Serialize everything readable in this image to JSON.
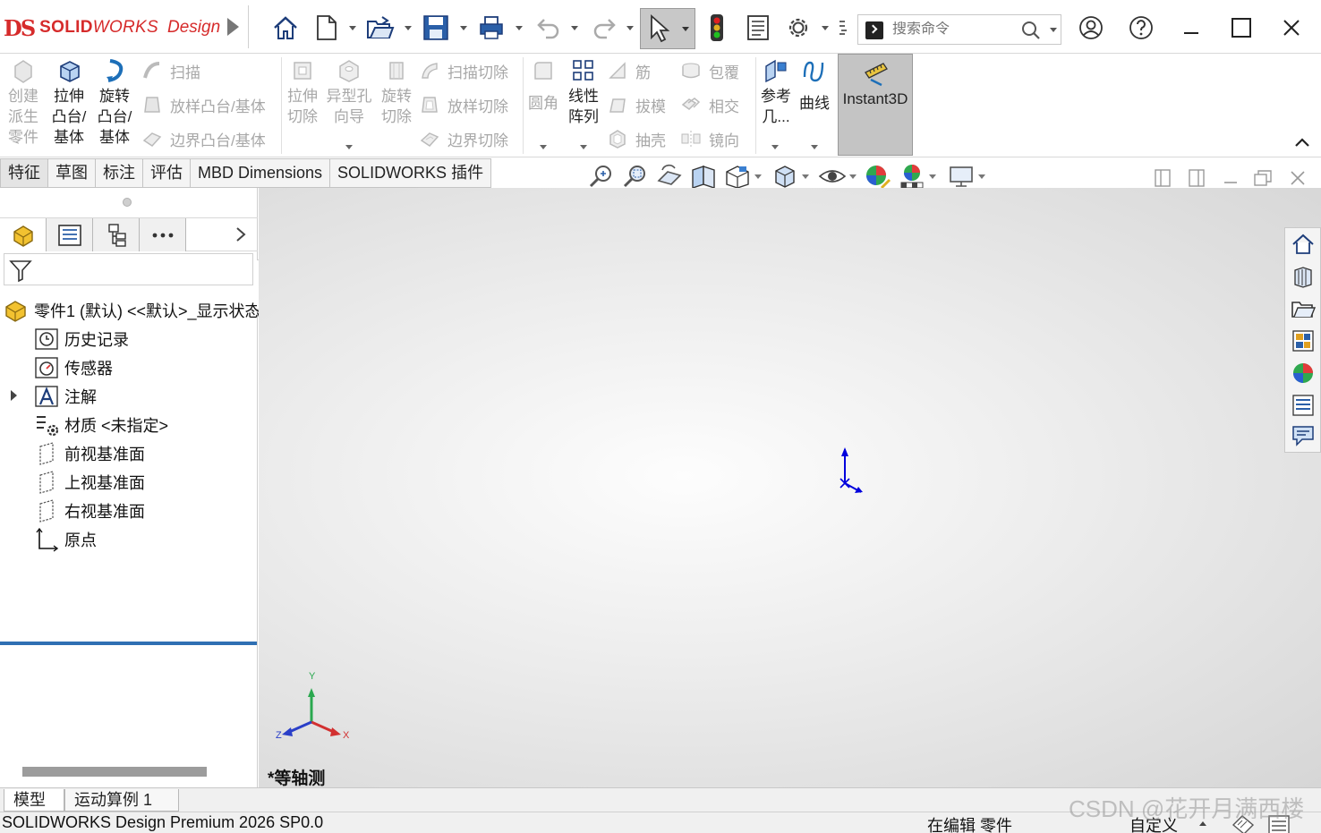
{
  "app": {
    "logo_ds": "DS",
    "logo_solid": "SOLID",
    "logo_works": "WORKS",
    "logo_design": "Design",
    "search_placeholder": "搜索命令"
  },
  "ribbon": {
    "create_derived": "创建\n派生\n零件",
    "extrude_boss": "拉伸\n凸台/\n基体",
    "revolve_boss": "旋转\n凸台/\n基体",
    "sweep": "扫描",
    "loft_boss": "放样凸台/基体",
    "boundary_boss": "边界凸台/基体",
    "extrude_cut": "拉伸\n切除",
    "hole_wizard": "异型孔\n向导",
    "revolve_cut": "旋转\n切除",
    "sweep_cut": "扫描切除",
    "loft_cut": "放样切除",
    "boundary_cut": "边界切除",
    "fillet": "圆角",
    "linear_pattern": "线性\n阵列",
    "rib": "筋",
    "draft": "拔模",
    "shell": "抽壳",
    "wrap": "包覆",
    "intersect": "相交",
    "mirror": "镜向",
    "reference_geometry": "参考\n几...",
    "curves": "曲线",
    "instant3d": "Instant3D"
  },
  "tabs": [
    "特征",
    "草图",
    "标注",
    "评估",
    "MBD Dimensions",
    "SOLIDWORKS 插件"
  ],
  "tree": {
    "root": "零件1 (默认) <<默认>_显示状态 1>",
    "items": [
      {
        "label": "历史记录",
        "icon": "history-icon"
      },
      {
        "label": "传感器",
        "icon": "sensor-icon"
      },
      {
        "label": "注解",
        "icon": "annotation-icon"
      },
      {
        "label": "材质 <未指定>",
        "icon": "material-icon"
      },
      {
        "label": "前视基准面",
        "icon": "plane-icon"
      },
      {
        "label": "上视基准面",
        "icon": "plane-icon"
      },
      {
        "label": "右视基准面",
        "icon": "plane-icon"
      },
      {
        "label": "原点",
        "icon": "origin-icon"
      }
    ]
  },
  "viewport": {
    "view_name": "*等轴测",
    "triad_x": "X",
    "triad_y": "Y",
    "triad_z": "Z"
  },
  "bottom_tabs": [
    "模型",
    "运动算例 1"
  ],
  "status": {
    "product": "SOLIDWORKS Design Premium 2026 SP0.0",
    "mode": "在编辑 零件",
    "units": "自定义",
    "watermark": "CSDN @花开月满西楼"
  },
  "colors": {
    "brand": "#d62b2b",
    "tree_underline": "#2f6fb3",
    "origin_blue": "#0000dd"
  }
}
